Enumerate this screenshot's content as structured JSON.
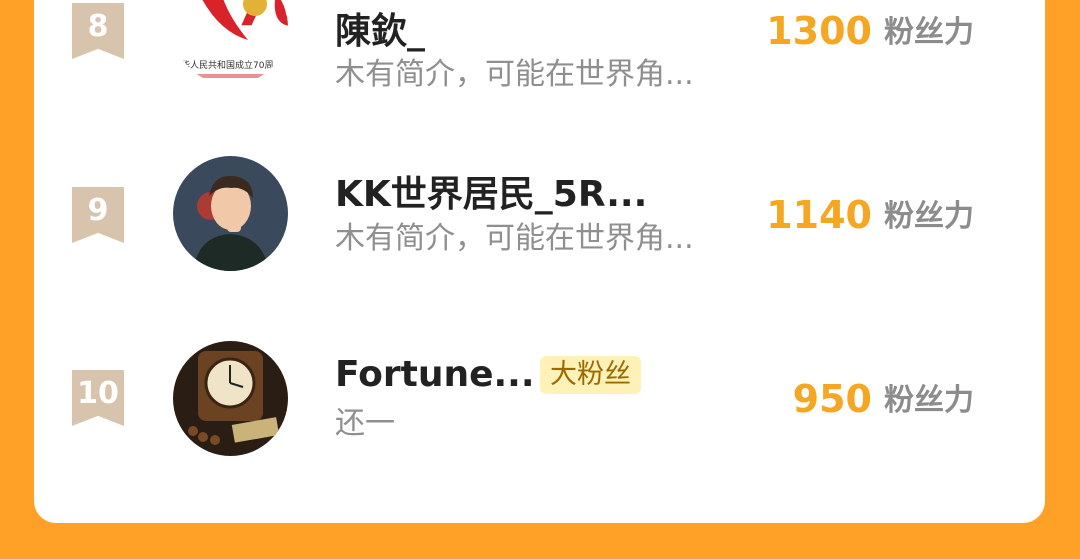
{
  "ranking": {
    "unit_label": "粉丝力",
    "rows": [
      {
        "rank": "8",
        "name": "陳欽_",
        "intro": "木有简介，可能在世界角...",
        "score": "1300",
        "badge": "",
        "avatar": "emblem-70-anniversary-avatar",
        "avatar_text": "华人民共和国成立70周"
      },
      {
        "rank": "9",
        "name": "KK世界居民_5R...",
        "intro": "木有简介，可能在世界角...",
        "score": "1140",
        "badge": "",
        "avatar": "illustrated-man-avatar"
      },
      {
        "rank": "10",
        "name": "Fortune...",
        "intro": "还一",
        "score": "950",
        "badge": "大粉丝",
        "avatar": "clock-photo-avatar"
      }
    ]
  },
  "colors": {
    "background": "#ffa126",
    "card": "#ffffff",
    "score": "#f5a623",
    "rank_badge": "#d8c4ac",
    "fan_badge_bg": "#fff1b8"
  }
}
